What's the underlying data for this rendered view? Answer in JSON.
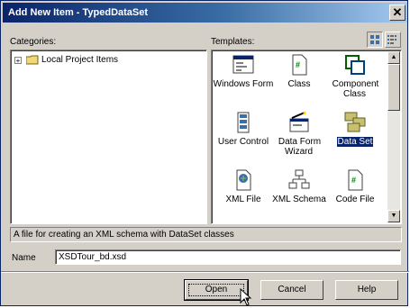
{
  "window": {
    "title": "Add New Item - TypedDataSet"
  },
  "categories": {
    "label": "Categories:",
    "items": [
      {
        "label": "Local Project Items",
        "expander": "+"
      }
    ]
  },
  "templates": {
    "label": "Templates:",
    "items": [
      {
        "label": "Windows Form",
        "icon": "windows-form-icon",
        "selected": false
      },
      {
        "label": "Class",
        "icon": "class-file-icon",
        "selected": false
      },
      {
        "label": "Component Class",
        "icon": "component-class-icon",
        "selected": false
      },
      {
        "label": "User Control",
        "icon": "user-control-icon",
        "selected": false
      },
      {
        "label": "Data Form Wizard",
        "icon": "data-form-wizard-icon",
        "selected": false
      },
      {
        "label": "Data Set",
        "icon": "dataset-icon",
        "selected": true
      },
      {
        "label": "XML File",
        "icon": "xml-file-icon",
        "selected": false
      },
      {
        "label": "XML Schema",
        "icon": "xml-schema-icon",
        "selected": false
      },
      {
        "label": "Code File",
        "icon": "code-file-icon",
        "selected": false
      }
    ]
  },
  "description": "A file for creating an XML schema with DataSet classes",
  "name_field": {
    "label": "Name",
    "value": "XSDTour_bd.xsd"
  },
  "buttons": {
    "open": "Open",
    "cancel": "Cancel",
    "help": "Help"
  },
  "colors": {
    "title_start": "#0a246a",
    "title_end": "#a6caf0",
    "dialog": "#d4d0c8",
    "selection": "#0a246a"
  }
}
